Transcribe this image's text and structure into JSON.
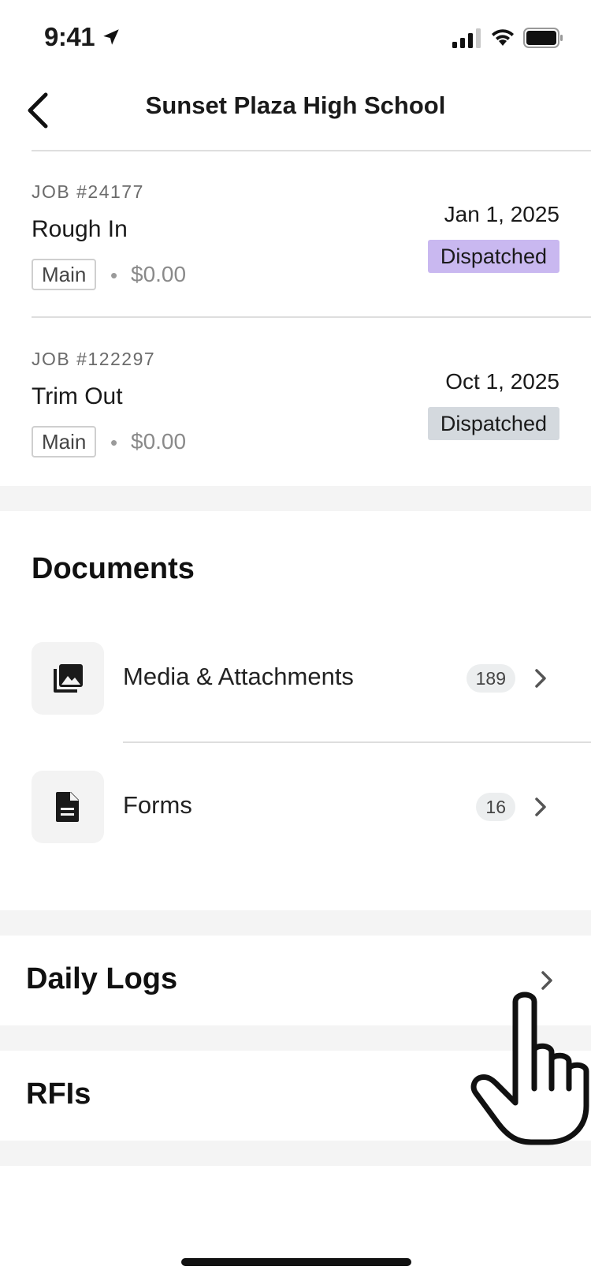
{
  "status_bar": {
    "time": "9:41"
  },
  "nav": {
    "title": "Sunset Plaza High School"
  },
  "jobs": [
    {
      "number": "JOB #24177",
      "name": "Rough In",
      "tag": "Main",
      "amount": "$0.00",
      "date": "Jan 1, 2025",
      "status": "Dispatched",
      "status_color": "#c9b8f0"
    },
    {
      "number": "JOB #122297",
      "name": "Trim Out",
      "tag": "Main",
      "amount": "$0.00",
      "date": "Oct 1, 2025",
      "status": "Dispatched",
      "status_color": "#d4d9de"
    }
  ],
  "documents": {
    "title": "Documents",
    "items": [
      {
        "label": "Media & Attachments",
        "count": "189",
        "icon": "media-gallery-icon"
      },
      {
        "label": "Forms",
        "count": "16",
        "icon": "document-icon"
      }
    ]
  },
  "sections": {
    "daily_logs": "Daily Logs",
    "rfis": "RFIs"
  },
  "colors": {
    "background": "#ffffff",
    "gap_gray": "#f4f4f4",
    "divider": "#dedede"
  }
}
